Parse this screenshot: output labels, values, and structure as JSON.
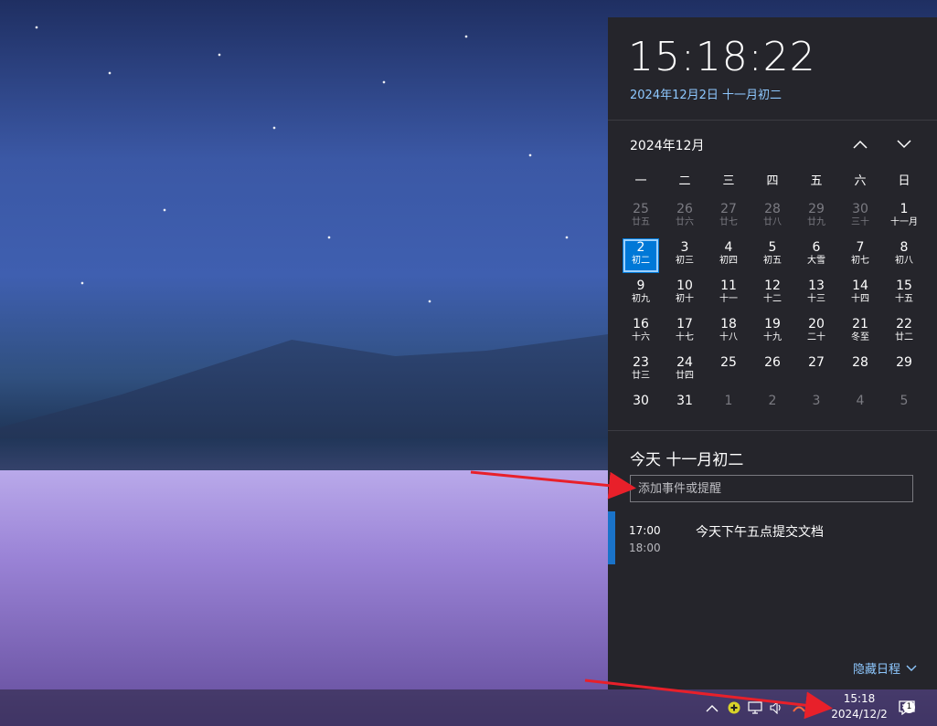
{
  "flyout": {
    "time": "15:18:22",
    "full_date": "2024年12月2日 十一月初二",
    "month_title": "2024年12月",
    "weekdays": [
      "一",
      "二",
      "三",
      "四",
      "五",
      "六",
      "日"
    ],
    "agenda_title": "今天 十一月初二",
    "event_placeholder": "添加事件或提醒",
    "event": {
      "start": "17:00",
      "end": "18:00",
      "title": "今天下午五点提交文档"
    },
    "hide_label": "隐藏日程"
  },
  "calendar": [
    {
      "d": "25",
      "l": "廿五",
      "other": true
    },
    {
      "d": "26",
      "l": "廿六",
      "other": true
    },
    {
      "d": "27",
      "l": "廿七",
      "other": true
    },
    {
      "d": "28",
      "l": "廿八",
      "other": true
    },
    {
      "d": "29",
      "l": "廿九",
      "other": true
    },
    {
      "d": "30",
      "l": "三十",
      "other": true
    },
    {
      "d": "1",
      "l": "十一月"
    },
    {
      "d": "2",
      "l": "初二",
      "today": true
    },
    {
      "d": "3",
      "l": "初三"
    },
    {
      "d": "4",
      "l": "初四"
    },
    {
      "d": "5",
      "l": "初五"
    },
    {
      "d": "6",
      "l": "大雪"
    },
    {
      "d": "7",
      "l": "初七"
    },
    {
      "d": "8",
      "l": "初八"
    },
    {
      "d": "9",
      "l": "初九"
    },
    {
      "d": "10",
      "l": "初十"
    },
    {
      "d": "11",
      "l": "十一"
    },
    {
      "d": "12",
      "l": "十二"
    },
    {
      "d": "13",
      "l": "十三"
    },
    {
      "d": "14",
      "l": "十四"
    },
    {
      "d": "15",
      "l": "十五"
    },
    {
      "d": "16",
      "l": "十六"
    },
    {
      "d": "17",
      "l": "十七"
    },
    {
      "d": "18",
      "l": "十八"
    },
    {
      "d": "19",
      "l": "十九"
    },
    {
      "d": "20",
      "l": "二十"
    },
    {
      "d": "21",
      "l": "冬至"
    },
    {
      "d": "22",
      "l": "廿二"
    },
    {
      "d": "23",
      "l": "廿三"
    },
    {
      "d": "24",
      "l": "廿四"
    },
    {
      "d": "25",
      "l": ""
    },
    {
      "d": "26",
      "l": ""
    },
    {
      "d": "27",
      "l": ""
    },
    {
      "d": "28",
      "l": ""
    },
    {
      "d": "29",
      "l": ""
    },
    {
      "d": "30",
      "l": ""
    },
    {
      "d": "31",
      "l": ""
    },
    {
      "d": "1",
      "l": "",
      "other": true
    },
    {
      "d": "2",
      "l": "",
      "other": true
    },
    {
      "d": "3",
      "l": "",
      "other": true
    },
    {
      "d": "4",
      "l": "",
      "other": true
    },
    {
      "d": "5",
      "l": "",
      "other": true
    }
  ],
  "taskbar": {
    "time": "15:18",
    "date": "2024/12/2",
    "notification_count": "1"
  },
  "colors": {
    "accent": "#0078d7",
    "link": "#8ec8ff",
    "flyout_bg": "#25252b",
    "arrow": "#e8202a"
  }
}
